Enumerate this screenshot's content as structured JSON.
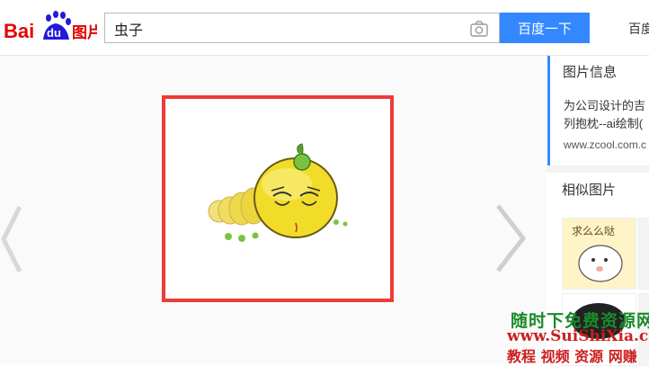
{
  "header": {
    "logo_text_left": "Bai",
    "logo_text_du": "du",
    "logo_text_right": "图片",
    "search_value": "虫子",
    "search_button": "百度一下",
    "nav_link": "百度"
  },
  "sidebar": {
    "info_title": "图片信息",
    "info_desc": "为公司设计的吉\n列抱枕--ai绘制(",
    "info_url": "www.zcool.com.c",
    "similar_title": "相似图片",
    "similar_thumb_text": "求么么哒"
  },
  "watermark": {
    "line1": "随时下免费资源网",
    "line2": "www.SuiShiXia.com",
    "line3": "教程 视频 资源 网赚"
  },
  "colors": {
    "accent": "#3388ff",
    "frame_red": "#ef3a3a",
    "logo_red": "#e10601",
    "logo_blue": "#2319dc"
  }
}
